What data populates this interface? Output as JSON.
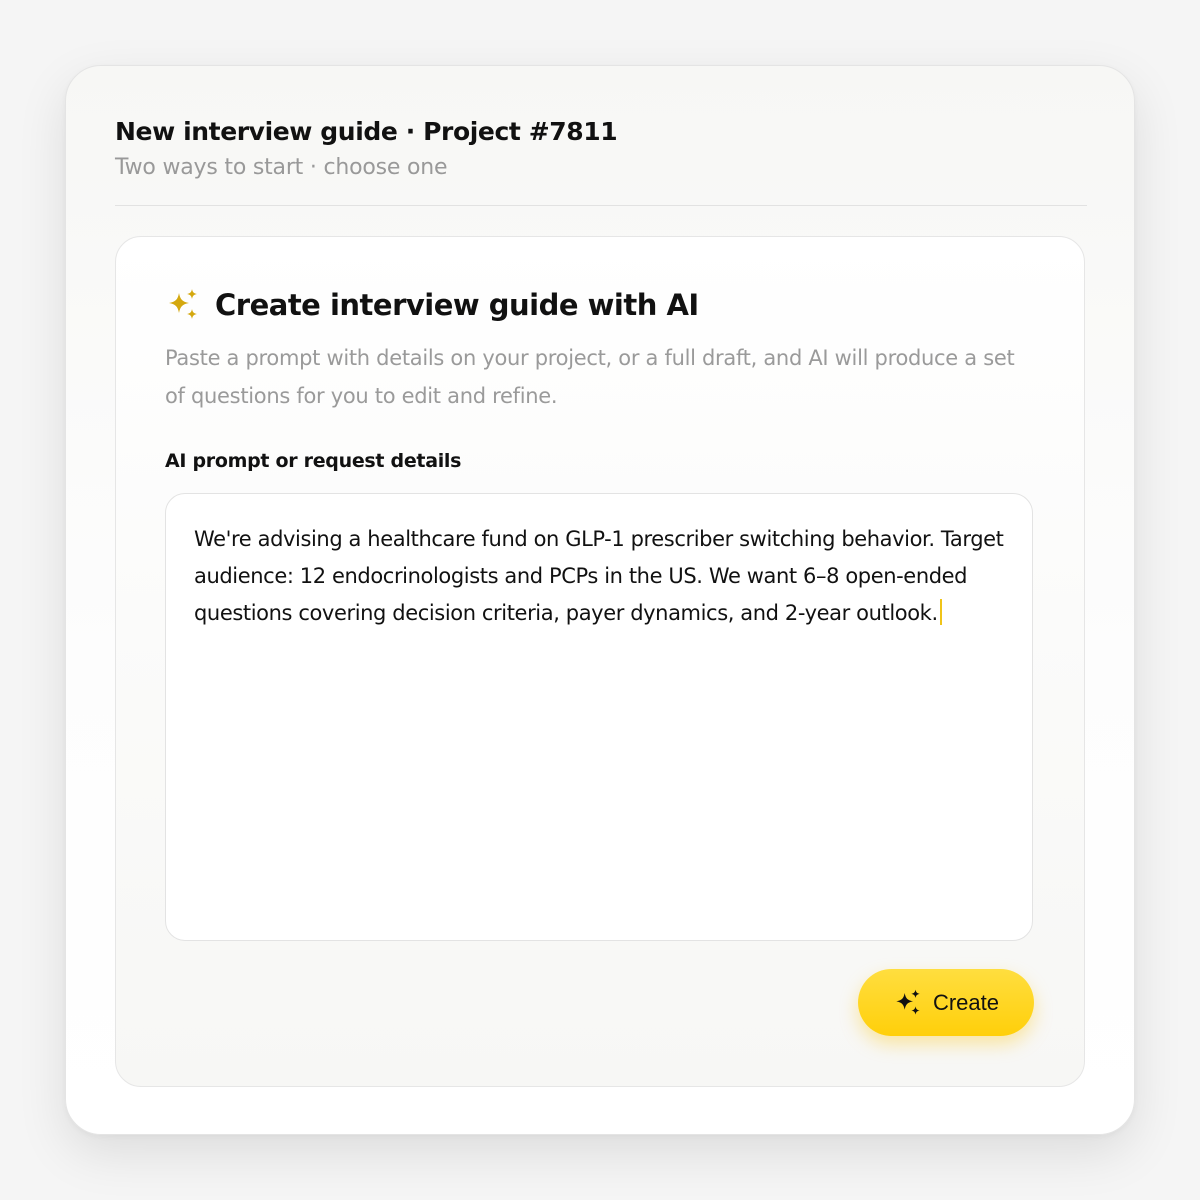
{
  "header": {
    "title": "New interview guide · Project #7811",
    "subtitle": "Two ways to start · choose one"
  },
  "card": {
    "icon": "sparkles-icon",
    "title": "Create interview guide with AI",
    "description": "Paste a prompt with details on your project, or a full draft, and AI will produce a set of questions for you to edit and refine.",
    "field_label": "AI prompt or request details",
    "prompt_value": "We're advising a healthcare fund on GLP-1 prescriber switching behavior. Target audience: 12 endocrinologists and PCPs in the US. We want 6–8 open-ended questions covering decision criteria, payer dynamics, and 2-year outlook.",
    "create_button": {
      "label": "Create",
      "icon": "sparkles-icon"
    }
  },
  "colors": {
    "accent": "#FFD21F",
    "sparkle_gold": "#D4A80F",
    "muted_text": "#9A9A9A"
  }
}
